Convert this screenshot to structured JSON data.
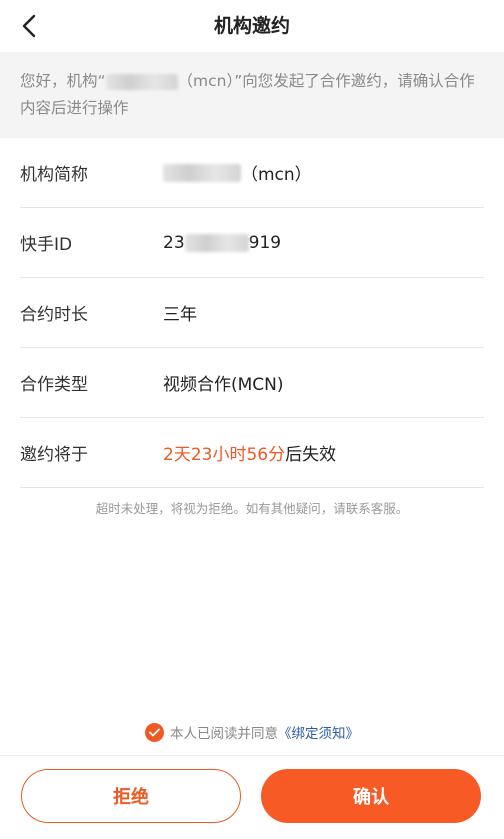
{
  "header": {
    "title": "机构邀约"
  },
  "notice": {
    "prefix": "您好，机构“",
    "suffix": "（mcn）”向您发起了合作邀约，请确认合作内容后进行操作"
  },
  "rows": [
    {
      "label": "机构简称",
      "value_suffix": "（mcn）"
    },
    {
      "label": "快手ID",
      "value_prefix": "23",
      "value_suffix": "919"
    },
    {
      "label": "合约时长",
      "value": "三年"
    },
    {
      "label": "合作类型",
      "value": "视频合作(MCN)"
    },
    {
      "label": "邀约将于",
      "countdown": "2天23小时56分",
      "value_suffix": "后失效"
    }
  ],
  "hint": "超时未处理，将视为拒绝。如有其他疑问，请联系客服。",
  "agreement": {
    "text": "本人已阅读并同意",
    "link": "《绑定须知》",
    "checked": true
  },
  "buttons": {
    "reject": "拒绝",
    "confirm": "确认"
  },
  "colors": {
    "accent": "#ee5a24",
    "link": "#2b5ca8"
  },
  "icons": {
    "back": "chevron-left-icon",
    "check": "check-circle-icon"
  }
}
